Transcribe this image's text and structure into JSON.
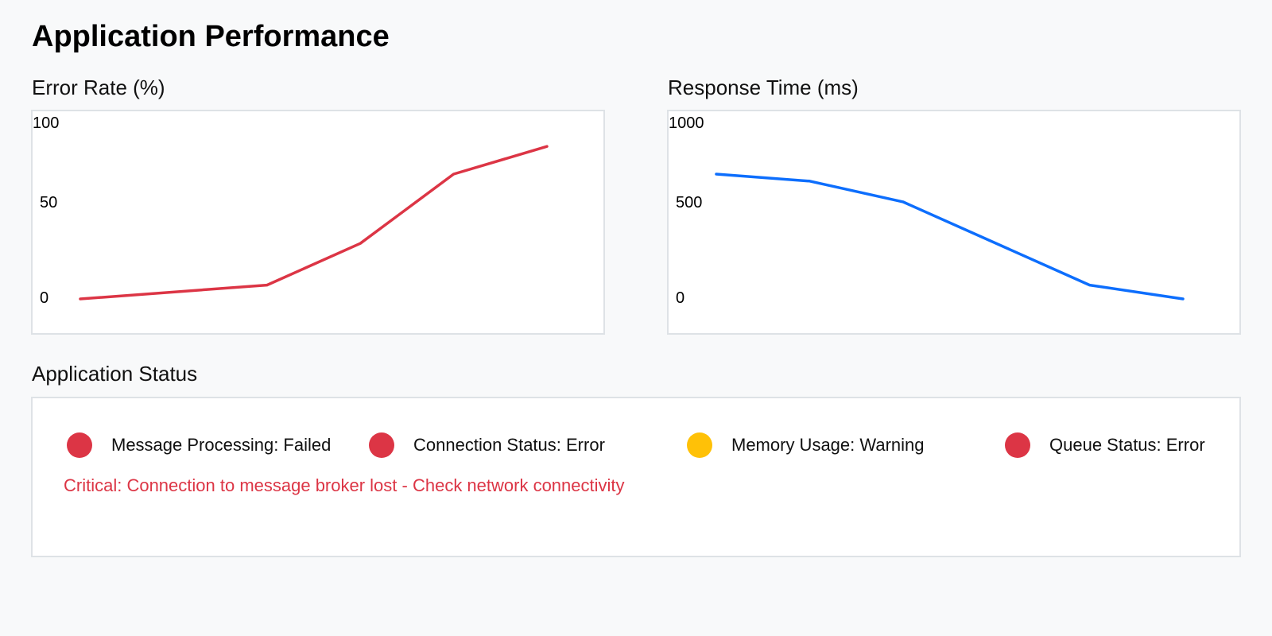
{
  "page": {
    "title": "Application Performance"
  },
  "colors": {
    "error": "#dc3545",
    "warning": "#ffc107",
    "response": "#0d6efd",
    "panel_border": "#dee2e6",
    "background": "#f8f9fa"
  },
  "chart_data": [
    {
      "type": "line",
      "title": "Error Rate (%)",
      "xlabel": "",
      "ylabel": "",
      "y_ticks": [
        "100",
        "50",
        "0"
      ],
      "ylim": [
        0,
        100
      ],
      "grid": false,
      "legend": "none",
      "color": "#dc3545",
      "series": [
        {
          "points": [
            {
              "x": 0,
              "y": 0
            },
            {
              "x": 2,
              "y": 8
            },
            {
              "x": 3,
              "y": 32
            },
            {
              "x": 4,
              "y": 72
            },
            {
              "x": 5,
              "y": 88
            }
          ]
        }
      ]
    },
    {
      "type": "line",
      "title": "Response Time (ms)",
      "xlabel": "",
      "ylabel": "",
      "y_ticks": [
        "1000",
        "500",
        "0"
      ],
      "ylim": [
        0,
        1000
      ],
      "grid": false,
      "legend": "none",
      "color": "#0d6efd",
      "series": [
        {
          "points": [
            {
              "x": 0,
              "y": 720
            },
            {
              "x": 1,
              "y": 680
            },
            {
              "x": 2,
              "y": 560
            },
            {
              "x": 4,
              "y": 80
            },
            {
              "x": 5,
              "y": 0
            }
          ]
        }
      ]
    }
  ],
  "status": {
    "title": "Application Status",
    "items": [
      {
        "label": "Message Processing: Failed",
        "level": "error",
        "color": "#dc3545"
      },
      {
        "label": "Connection Status: Error",
        "level": "error",
        "color": "#dc3545"
      },
      {
        "label": "Memory Usage: Warning",
        "level": "warning",
        "color": "#ffc107"
      },
      {
        "label": "Queue Status: Error",
        "level": "error",
        "color": "#dc3545"
      }
    ],
    "alert": "Critical: Connection to message broker lost - Check network connectivity",
    "alert_color": "#dc3545"
  }
}
